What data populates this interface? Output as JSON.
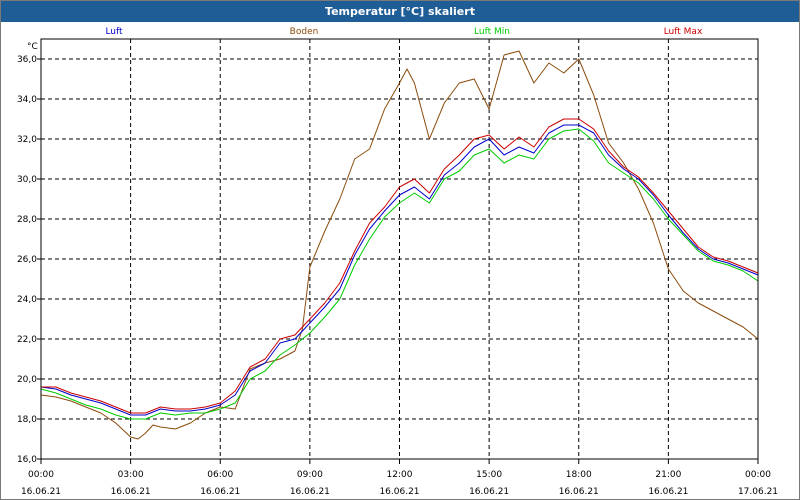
{
  "window": {
    "title": "Temperatur [°C] skaliert"
  },
  "chart_data": {
    "type": "line",
    "title": "Temperatur [°C] skaliert",
    "ylabel": "°C",
    "ylim": [
      16,
      37
    ],
    "yticks": [
      16,
      18,
      20,
      22,
      24,
      26,
      28,
      30,
      32,
      34,
      36
    ],
    "ytick_labels": [
      "16,0",
      "18,0",
      "20,0",
      "22,0",
      "24,0",
      "26,0",
      "28,0",
      "30,0",
      "32,0",
      "34,0",
      "36,0"
    ],
    "xlim": [
      0,
      24
    ],
    "x_units": "hours since 16.06.21 00:00",
    "xticks": [
      {
        "time": "00:00",
        "date": "16.06.21"
      },
      {
        "time": "03:00",
        "date": "16.06.21"
      },
      {
        "time": "06:00",
        "date": "16.06.21"
      },
      {
        "time": "09:00",
        "date": "16.06.21"
      },
      {
        "time": "12:00",
        "date": "16.06.21"
      },
      {
        "time": "15:00",
        "date": "16.06.21"
      },
      {
        "time": "18:00",
        "date": "16.06.21"
      },
      {
        "time": "21:00",
        "date": "16.06.21"
      },
      {
        "time": "00:00",
        "date": "17.06.21"
      }
    ],
    "grid": true,
    "legend": "top",
    "series": [
      {
        "name": "Luft",
        "color": "#0000cc",
        "x": [
          0,
          0.5,
          1,
          1.5,
          2,
          2.5,
          3,
          3.5,
          4,
          4.5,
          5,
          5.5,
          6,
          6.5,
          7,
          7.5,
          8,
          8.5,
          9,
          9.5,
          10,
          10.5,
          11,
          11.5,
          12,
          12.5,
          13,
          13.5,
          14,
          14.5,
          15,
          15.5,
          16,
          16.5,
          17,
          17.5,
          18,
          18.5,
          19,
          19.5,
          20,
          20.5,
          21,
          21.5,
          22,
          22.5,
          23,
          23.5,
          24
        ],
        "y": [
          19.6,
          19.5,
          19.2,
          19,
          18.8,
          18.5,
          18.2,
          18.2,
          18.5,
          18.4,
          18.4,
          18.5,
          18.7,
          19.2,
          20.4,
          20.8,
          21.8,
          22,
          22.8,
          23.6,
          24.5,
          26.2,
          27.5,
          28.4,
          29.2,
          29.6,
          29,
          30.2,
          30.8,
          31.6,
          32,
          31.2,
          31.6,
          31.3,
          32.3,
          32.7,
          32.7,
          32.3,
          31.2,
          30.5,
          30,
          29.2,
          28.2,
          27.3,
          26.5,
          26,
          25.8,
          25.5,
          25.2
        ]
      },
      {
        "name": "Boden",
        "color": "#8b4c0c",
        "x": [
          0,
          0.5,
          1,
          1.5,
          2,
          2.5,
          3,
          3.25,
          3.5,
          3.75,
          4,
          4.5,
          5,
          5.5,
          6,
          6.5,
          7,
          7.5,
          8,
          8.5,
          8.75,
          9,
          9.5,
          10,
          10.5,
          11,
          11.5,
          12,
          12.25,
          12.5,
          13,
          13.5,
          14,
          14.5,
          15,
          15.5,
          16,
          16.5,
          17,
          17.5,
          18,
          18.5,
          19,
          19.5,
          20,
          20.5,
          21,
          21.5,
          22,
          22.5,
          23,
          23.5,
          24
        ],
        "y": [
          19.2,
          19.1,
          18.9,
          18.6,
          18.3,
          17.8,
          17.1,
          17,
          17.3,
          17.7,
          17.6,
          17.5,
          17.8,
          18.3,
          18.6,
          18.5,
          20.5,
          20.8,
          21,
          21.4,
          22.5,
          25.6,
          27.4,
          29,
          31,
          31.5,
          33.5,
          34.8,
          35.5,
          34.8,
          32,
          33.8,
          34.8,
          35,
          33.5,
          36.2,
          36.4,
          34.8,
          35.8,
          35.3,
          36,
          34.2,
          31.8,
          30.8,
          29.5,
          27.8,
          25.5,
          24.4,
          23.8,
          23.4,
          23,
          22.6,
          22
        ]
      },
      {
        "name": "Luft Min",
        "color": "#00cc00",
        "x": [
          0,
          0.5,
          1,
          1.5,
          2,
          2.5,
          3,
          3.5,
          4,
          4.5,
          5,
          5.5,
          6,
          6.5,
          7,
          7.5,
          8,
          8.5,
          9,
          9.5,
          10,
          10.5,
          11,
          11.5,
          12,
          12.5,
          13,
          13.5,
          14,
          14.5,
          15,
          15.5,
          16,
          16.5,
          17,
          17.5,
          18,
          18.5,
          19,
          19.5,
          20,
          20.5,
          21,
          21.5,
          22,
          22.5,
          23,
          23.5,
          24
        ],
        "y": [
          19.5,
          19.3,
          19,
          18.7,
          18.5,
          18.2,
          18,
          18,
          18.3,
          18.2,
          18.3,
          18.3,
          18.5,
          18.8,
          20,
          20.4,
          21.2,
          21.7,
          22.3,
          23.1,
          24,
          25.7,
          27,
          28.1,
          28.8,
          29.3,
          28.8,
          30,
          30.4,
          31.2,
          31.5,
          30.8,
          31.2,
          31,
          32,
          32.4,
          32.5,
          31.9,
          30.8,
          30.3,
          29.8,
          29,
          28,
          27.2,
          26.4,
          25.9,
          25.7,
          25.4,
          24.9
        ]
      },
      {
        "name": "Luft Max",
        "color": "#cc0000",
        "x": [
          0,
          0.5,
          1,
          1.5,
          2,
          2.5,
          3,
          3.5,
          4,
          4.5,
          5,
          5.5,
          6,
          6.5,
          7,
          7.5,
          8,
          8.5,
          9,
          9.5,
          10,
          10.5,
          11,
          11.5,
          12,
          12.5,
          13,
          13.5,
          14,
          14.5,
          15,
          15.5,
          16,
          16.5,
          17,
          17.5,
          18,
          18.5,
          19,
          19.5,
          20,
          20.5,
          21,
          21.5,
          22,
          22.5,
          23,
          23.5,
          24
        ],
        "y": [
          19.6,
          19.6,
          19.3,
          19.1,
          18.9,
          18.6,
          18.3,
          18.3,
          18.6,
          18.5,
          18.5,
          18.6,
          18.8,
          19.4,
          20.6,
          21,
          22,
          22.2,
          23,
          23.8,
          24.8,
          26.4,
          27.8,
          28.6,
          29.6,
          30,
          29.3,
          30.5,
          31.2,
          32,
          32.2,
          31.5,
          32.1,
          31.6,
          32.6,
          33,
          33,
          32.5,
          31.4,
          30.6,
          30.1,
          29.3,
          28.4,
          27.5,
          26.6,
          26.1,
          25.9,
          25.6,
          25.3
        ]
      }
    ]
  }
}
